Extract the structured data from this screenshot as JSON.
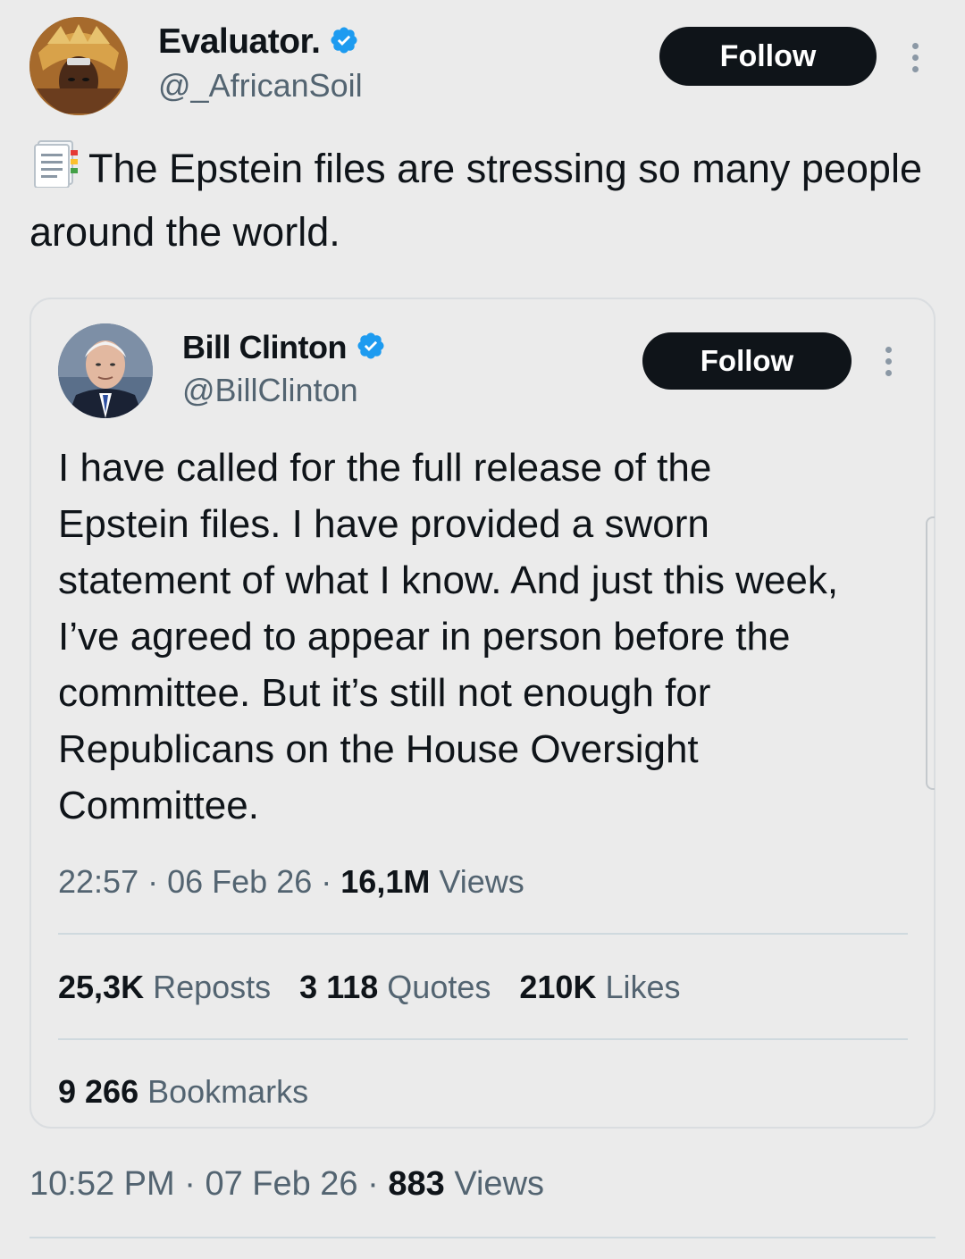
{
  "main_tweet": {
    "display_name": "Evaluator.",
    "handle": "@_AfricanSoil",
    "follow_label": "Follow",
    "text": "The Epstein files are stressing so many people around the world.",
    "emoji_icon": "bookmark-tabs-icon",
    "time": "10:52 PM",
    "date": "07 Feb 26",
    "views_count": "883",
    "views_label": "Views",
    "sep": "·"
  },
  "quoted_tweet": {
    "display_name": "Bill Clinton",
    "handle": "@BillClinton",
    "follow_label": "Follow",
    "text": "I have called for the full release of the Epstein files. I have provided a sworn statement of what I know. And just this week, I’ve agreed to appear in person before the committee. But it’s still not enough for Republicans on the House Oversight Committee.",
    "time": "22:57",
    "date": "06 Feb 26",
    "views_count": "16,1M",
    "views_label": "Views",
    "sep": "·",
    "reposts_count": "25,3K",
    "reposts_label": "Reposts",
    "quotes_count": "3 118",
    "quotes_label": "Quotes",
    "likes_count": "210K",
    "likes_label": "Likes",
    "bookmarks_count": "9 266",
    "bookmarks_label": "Bookmarks"
  },
  "colors": {
    "background": "#ebebeb",
    "verified_blue": "#1d9bf0",
    "button_dark": "#0f1419",
    "secondary_text": "#536471"
  }
}
